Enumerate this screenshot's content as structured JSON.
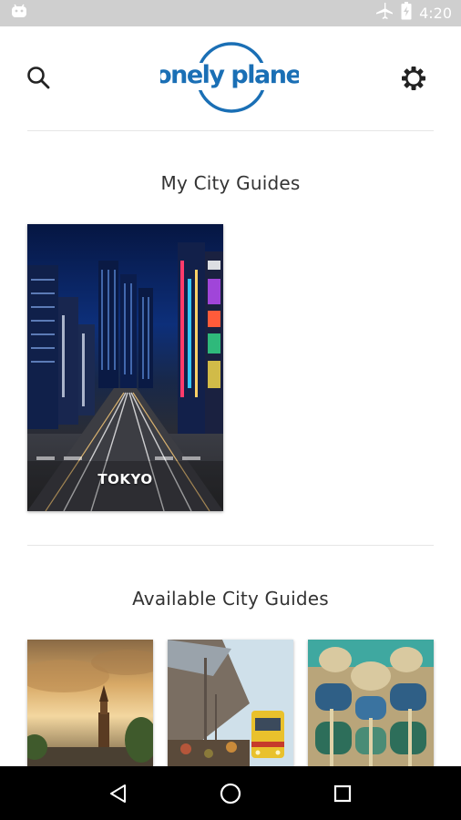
{
  "status_bar": {
    "time": "4:20",
    "icons": [
      "android-icon",
      "airplane-mode-icon",
      "battery-charging-icon"
    ]
  },
  "header": {
    "logo_text": "lonely planet",
    "search_icon": "search-icon",
    "settings_icon": "settings-gear-icon",
    "brand_color": "#1a6fb5"
  },
  "my_guides": {
    "title": "My City Guides",
    "items": [
      {
        "label": "TOKYO"
      }
    ]
  },
  "available_guides": {
    "title": "Available City Guides",
    "items": [
      {
        "image": "amsterdam-tower-thumbnail"
      },
      {
        "image": "bangkok-market-train-thumbnail"
      },
      {
        "image": "barcelona-casa-batllo-thumbnail"
      }
    ]
  },
  "nav_bar": {
    "icons": [
      "back-icon",
      "home-icon",
      "recents-icon"
    ]
  }
}
